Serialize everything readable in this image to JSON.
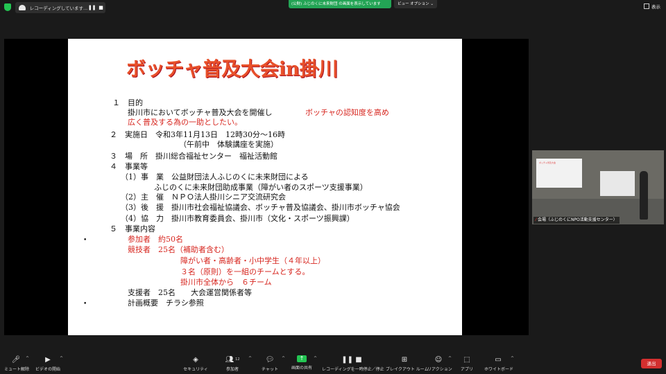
{
  "topbar": {
    "recording_text": "レコーディングしています...",
    "pause_icon": "pause-icon",
    "stop_icon": "stop-icon",
    "share_banner": "(公財) ふじのくに未来財団 の画面を表示しています",
    "view_options": "ビュー オプション ⌄",
    "display_label": "表示"
  },
  "slide": {
    "title": "ボッチャ普及大会in掛川",
    "lines": [
      "１　目的",
      "掛川市においてボッチャ普及大会を開催し",
      "ボッチャの認知度を高め",
      "広く普及する為の一助としたい。",
      "２　実施日　令和3年11月13日　12時30分～16時",
      "（午前中　体験講座を実施）",
      "３　場　所　掛川総合福祉センター　福祉活動館",
      "４　事業等",
      "（1）事　業　公益財団法人ふじのくに未来財団による",
      "ふじのくに未来財団助成事業（障がい者のスポーツ支援事業）",
      "（2）主　催　ＮＰＯ法人掛川シニア交流研究会",
      "（3）後　援　掛川市社会福祉協議会、ボッチャ普及協議会、掛川市ボッチャ協会",
      "（4）協　力　掛川市教育委員会、掛川市（文化・スポーツ振興課）",
      "５　事業内容",
      "参加者　約50名",
      "競技者　25名（補助者含む）",
      "障がい者・高齢者・小中学生（４年以上）",
      "３名（原則）を一組のチームとする。",
      "掛川市全体から　６チーム",
      "支援者　25名　　大会運営関係者等",
      "計画概要　チラシ参照"
    ],
    "bullets": [
      "•",
      "•"
    ]
  },
  "video": {
    "label": "会場（ふじのくにNPO活動支援センター）",
    "board_text": "ボッチャ普及大会"
  },
  "toolbar": {
    "mute": "ミュート解除",
    "video": "ビデオの開始",
    "security": "セキュリティ",
    "participants": "参加者",
    "participants_count": "12",
    "chat": "チャット",
    "share": "画面の共有",
    "recording": "レコーディングを一時停止／停止",
    "breakout": "ブレイクアウト ルーム",
    "reactions": "リアクション",
    "apps": "アプリ",
    "whiteboard": "ホワイトボード",
    "end": "退出"
  },
  "colors": {
    "accent": "#23c552",
    "end": "#d32f2f",
    "title": "#e8502a",
    "red_text": "#d7261f"
  }
}
